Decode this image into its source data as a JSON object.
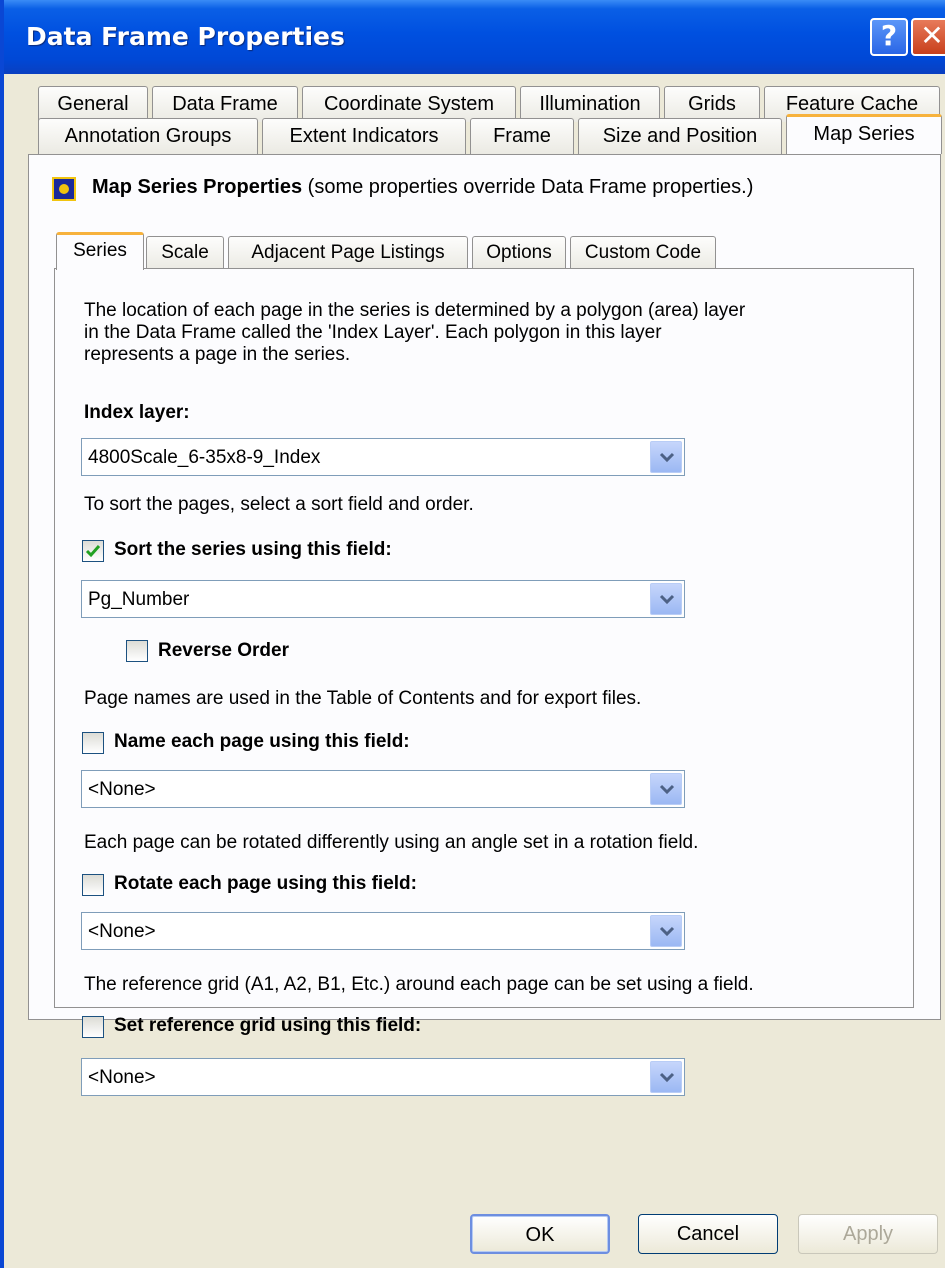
{
  "window": {
    "title": "Data Frame Properties",
    "help_glyph": "?",
    "close_glyph": "✕"
  },
  "tabs_row1": [
    "General",
    "Data Frame",
    "Coordinate System",
    "Illumination",
    "Grids",
    "Feature Cache"
  ],
  "tabs_row2": [
    "Annotation Groups",
    "Extent Indicators",
    "Frame",
    "Size and Position",
    "Map Series"
  ],
  "selected_tab": "Map Series",
  "map_series": {
    "title_bold": "Map Series Properties",
    "title_note": "(some properties override Data Frame properties.)",
    "inner_tabs": [
      "Series",
      "Scale",
      "Adjacent Page Listings",
      "Options",
      "Custom Code"
    ],
    "selected_inner_tab": "Series",
    "description_lines": [
      "The location of each page in the series is determined by a polygon (area) layer",
      "in the Data Frame called the 'Index Layer'.  Each polygon in this layer",
      "represents a page in the series."
    ],
    "index_layer_label": "Index layer:",
    "index_layer_value": "4800Scale_6-35x8-9_Index",
    "sort_hint": "To sort the pages, select a sort field and order.",
    "sort_checkbox_label": "Sort the series using this field:",
    "sort_checked": true,
    "sort_field_value": "Pg_Number",
    "reverse_order_label": "Reverse Order",
    "reverse_checked": false,
    "name_hint": "Page names are used in the Table of Contents and for export files.",
    "name_checkbox_label": "Name each page using this field:",
    "name_checked": false,
    "name_field_value": "<None>",
    "rotate_hint": "Each page can be rotated differently using an angle set in a rotation field.",
    "rotate_checkbox_label": "Rotate each page using this field:",
    "rotate_checked": false,
    "rotate_field_value": "<None>",
    "grid_hint": "The reference grid (A1, A2, B1, Etc.) around each page can be set using a field.",
    "grid_checkbox_label": "Set reference grid using this field:",
    "grid_checked": false,
    "grid_field_value": "<None>"
  },
  "buttons": {
    "ok": "OK",
    "cancel": "Cancel",
    "apply": "Apply"
  },
  "colors": {
    "titlebar": "#0050e0",
    "tab_highlight": "#f7b23c",
    "checkmark": "#21a121"
  }
}
